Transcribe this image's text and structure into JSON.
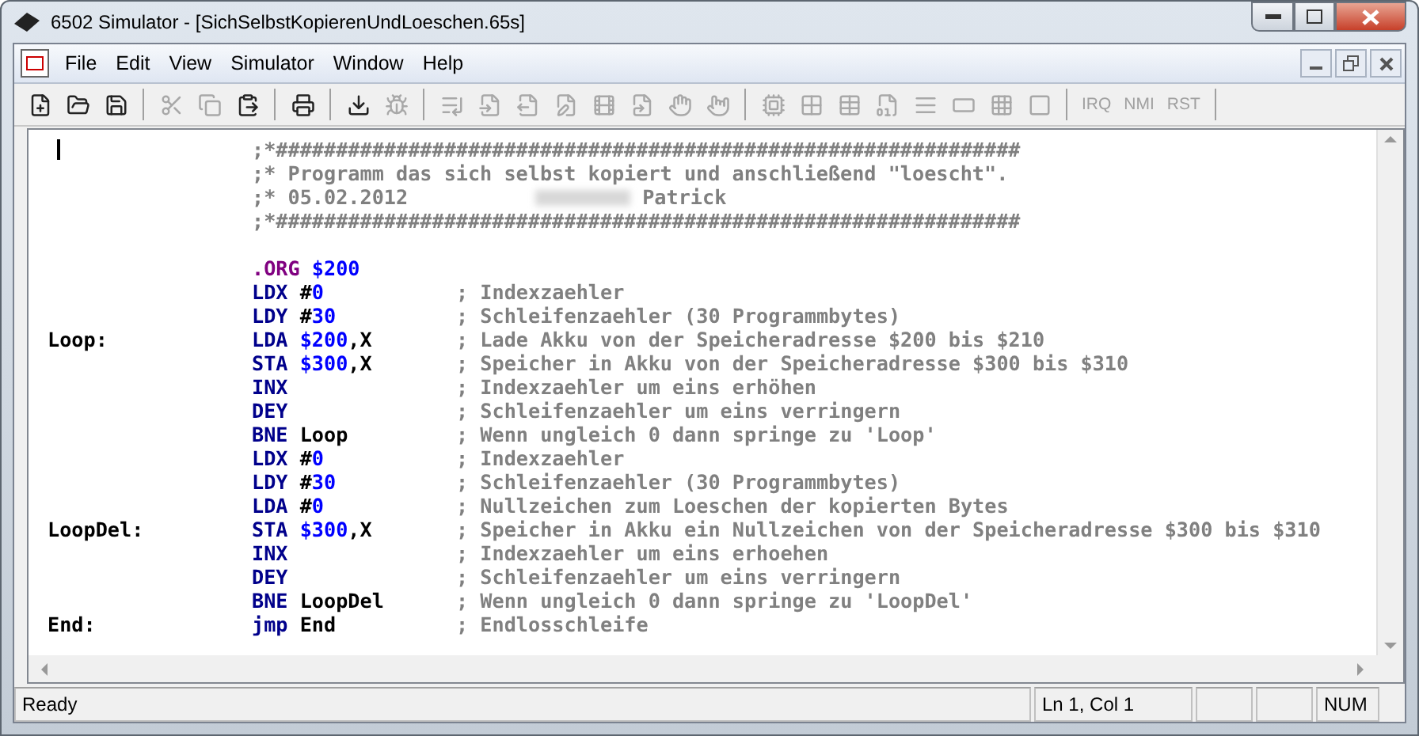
{
  "window": {
    "title": "6502 Simulator - [SichSelbstKopierenUndLoeschen.65s]"
  },
  "menu": [
    "File",
    "Edit",
    "View",
    "Simulator",
    "Window",
    "Help"
  ],
  "toolbar": {
    "groups": [
      [
        {
          "disabled": false
        },
        {
          "disabled": false
        },
        {
          "disabled": false
        }
      ],
      [
        {
          "disabled": true
        },
        {
          "disabled": true
        },
        {
          "disabled": false
        }
      ],
      [
        {
          "disabled": false
        }
      ],
      [
        {
          "disabled": false
        },
        {
          "disabled": true
        }
      ],
      [
        {
          "disabled": true
        },
        {
          "disabled": true
        },
        {
          "disabled": true
        },
        {
          "disabled": true
        },
        {
          "disabled": true
        },
        {
          "disabled": true
        },
        {
          "disabled": true
        },
        {
          "disabled": true
        }
      ],
      [
        {
          "disabled": true
        },
        {
          "disabled": true
        },
        {
          "disabled": true
        },
        {
          "disabled": true
        },
        {
          "disabled": true
        },
        {
          "disabled": true
        },
        {
          "disabled": true
        },
        {
          "disabled": true
        }
      ]
    ],
    "signal_buttons": [
      {
        "label": "IRQ",
        "disabled": true
      },
      {
        "label": "NMI",
        "disabled": true
      },
      {
        "label": "RST",
        "disabled": true
      }
    ]
  },
  "editor": {
    "lines": [
      {
        "kind": "comment",
        "text": ";*##############################################################"
      },
      {
        "kind": "comment",
        "text": ";* Programm das sich selbst kopiert und anschließend \"loescht\"."
      },
      {
        "kind": "comment",
        "text": ";* 05.02.2012",
        "blurred_after": true,
        "text_after": "Patrick"
      },
      {
        "kind": "comment",
        "text": ";*##############################################################"
      },
      {
        "kind": "blank"
      },
      {
        "kind": "code",
        "tokens": [
          {
            "kind": "directive",
            "text": ".ORG"
          },
          {
            "kind": "number",
            "text": " $200"
          }
        ]
      },
      {
        "kind": "code",
        "tokens": [
          {
            "kind": "mnemonic",
            "text": "LDX"
          },
          {
            "kind": "plain",
            "text": " #"
          },
          {
            "kind": "number",
            "text": "0"
          }
        ],
        "comment": "; Indexzaehler"
      },
      {
        "kind": "code",
        "tokens": [
          {
            "kind": "mnemonic",
            "text": "LDY"
          },
          {
            "kind": "plain",
            "text": " #"
          },
          {
            "kind": "number",
            "text": "30"
          }
        ],
        "comment": "; Schleifenzaehler (30 Programmbytes)"
      },
      {
        "kind": "code",
        "label": "Loop:",
        "tokens": [
          {
            "kind": "mnemonic",
            "text": "LDA"
          },
          {
            "kind": "number",
            "text": " $200"
          },
          {
            "kind": "plain",
            "text": ",X"
          }
        ],
        "comment": "; Lade Akku von der Speicheradresse $200 bis $210"
      },
      {
        "kind": "code",
        "tokens": [
          {
            "kind": "mnemonic",
            "text": "STA"
          },
          {
            "kind": "number",
            "text": " $300"
          },
          {
            "kind": "plain",
            "text": ",X"
          }
        ],
        "comment": "; Speicher in Akku von der Speicheradresse $300 bis $310"
      },
      {
        "kind": "code",
        "tokens": [
          {
            "kind": "mnemonic",
            "text": "INX"
          }
        ],
        "comment": "; Indexzaehler um eins erhöhen"
      },
      {
        "kind": "code",
        "tokens": [
          {
            "kind": "mnemonic",
            "text": "DEY"
          }
        ],
        "comment": "; Schleifenzaehler um eins verringern"
      },
      {
        "kind": "code",
        "tokens": [
          {
            "kind": "mnemonic",
            "text": "BNE"
          },
          {
            "kind": "plain",
            "text": " Loop"
          }
        ],
        "comment": "; Wenn ungleich 0 dann springe zu 'Loop'"
      },
      {
        "kind": "code",
        "tokens": [
          {
            "kind": "mnemonic",
            "text": "LDX"
          },
          {
            "kind": "plain",
            "text": " #"
          },
          {
            "kind": "number",
            "text": "0"
          }
        ],
        "comment": "; Indexzaehler"
      },
      {
        "kind": "code",
        "tokens": [
          {
            "kind": "mnemonic",
            "text": "LDY"
          },
          {
            "kind": "plain",
            "text": " #"
          },
          {
            "kind": "number",
            "text": "30"
          }
        ],
        "comment": "; Schleifenzaehler (30 Programmbytes)"
      },
      {
        "kind": "code",
        "tokens": [
          {
            "kind": "mnemonic",
            "text": "LDA"
          },
          {
            "kind": "plain",
            "text": " #"
          },
          {
            "kind": "number",
            "text": "0"
          }
        ],
        "comment": "; Nullzeichen zum Loeschen der kopierten Bytes"
      },
      {
        "kind": "code",
        "label": "LoopDel:",
        "tokens": [
          {
            "kind": "mnemonic",
            "text": "STA"
          },
          {
            "kind": "number",
            "text": " $300"
          },
          {
            "kind": "plain",
            "text": ",X"
          }
        ],
        "comment": "; Speicher in Akku ein Nullzeichen von der Speicheradresse $300 bis $310"
      },
      {
        "kind": "code",
        "tokens": [
          {
            "kind": "mnemonic",
            "text": "INX"
          }
        ],
        "comment": "; Indexzaehler um eins erhoehen"
      },
      {
        "kind": "code",
        "tokens": [
          {
            "kind": "mnemonic",
            "text": "DEY"
          }
        ],
        "comment": "; Schleifenzaehler um eins verringern"
      },
      {
        "kind": "code",
        "tokens": [
          {
            "kind": "mnemonic",
            "text": "BNE"
          },
          {
            "kind": "plain",
            "text": " LoopDel"
          }
        ],
        "comment": "; Wenn ungleich 0 dann springe zu 'LoopDel'"
      },
      {
        "kind": "code",
        "label": "End:",
        "tokens": [
          {
            "kind": "mnemonic",
            "text": "jmp"
          },
          {
            "kind": "plain",
            "text": " End"
          }
        ],
        "comment": "; Endlosschleife"
      }
    ]
  },
  "status_bar": {
    "message": "Ready",
    "position": "Ln 1, Col 1",
    "indicator": "NUM"
  }
}
